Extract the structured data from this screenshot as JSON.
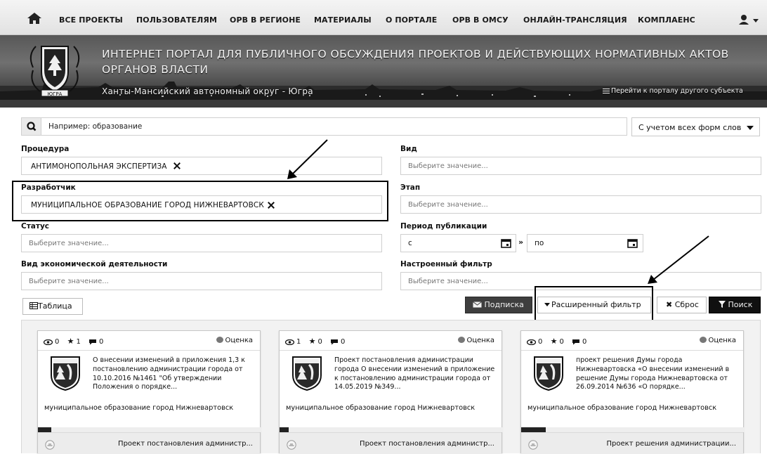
{
  "nav": {
    "items": [
      "ВСЕ ПРОЕКТЫ",
      "ПОЛЬЗОВАТЕЛЯМ",
      "ОРВ В РЕГИОНЕ",
      "МАТЕРИАЛЫ",
      "О ПОРТАЛЕ",
      "ОРВ В ОМСУ",
      "ОНЛАЙН-ТРАНСЛЯЦИЯ",
      "КОМПЛАЕНС"
    ],
    "home_icon": "home-icon",
    "user_icon": "user-icon"
  },
  "banner": {
    "title": "ИНТЕРНЕТ ПОРТАЛ ДЛЯ ПУБЛИЧНОГО ОБСУЖДЕНИЯ ПРОЕКТОВ И ДЕЙСТВУЮЩИХ НОРМАТИВНЫХ АКТОВ ОРГАНОВ ВЛАСТИ",
    "region": "Ханты-Мансийский автономный округ - Югра",
    "emblem_text": "ЮГРА",
    "other_portal_link": "Перейти к порталу другого субъекта"
  },
  "search": {
    "placeholder": "Например: образование",
    "wordform_select": "С учетом всех форм слов"
  },
  "filters": {
    "procedure": {
      "label": "Процедура",
      "value": "АНТИМОНОПОЛЬНАЯ ЭКСПЕРТИЗА"
    },
    "developer": {
      "label": "Разработчик",
      "value": "МУНИЦИПАЛЬНОЕ ОБРАЗОВАНИЕ ГОРОД НИЖНЕВАРТОВСК"
    },
    "status": {
      "label": "Статус",
      "placeholder": "Выберите значение..."
    },
    "activity": {
      "label": "Вид экономической деятельности",
      "placeholder": "Выберите значение..."
    },
    "kind": {
      "label": "Вид",
      "placeholder": "Выберите значение..."
    },
    "stage": {
      "label": "Этап",
      "placeholder": "Выберите значение..."
    },
    "period": {
      "label": "Период публикации",
      "from": "с",
      "to": "по",
      "separator": "»"
    },
    "saved": {
      "label": "Настроенный фильтр",
      "placeholder": "Выберите значение..."
    }
  },
  "buttons": {
    "table": "Таблица",
    "subscribe": "Подписка",
    "advanced": "Расширенный фильтр",
    "reset": "Сброс",
    "search": "Поиск"
  },
  "cards": [
    {
      "views": "0",
      "favorites": "1",
      "comments": "0",
      "rating": "Оценка",
      "description": "О внесении изменений в приложения 1,3 к постановлению администрации города от 10.10.2016 №1461 \"Об утверждении Положения о порядке...",
      "org": "муниципальное образование город Нижневартовск",
      "progress": 0.06,
      "type": "Проект постановления администр..."
    },
    {
      "views": "1",
      "favorites": "0",
      "comments": "0",
      "rating": "Оценка",
      "description": "Проект постановления администрации города О внесении изменений в приложение к постановлению администрации города от 14.05.2019 №349...",
      "org": "муниципальное образование город Нижневартовск",
      "progress": 0.04,
      "type": "Проект постановления администр..."
    },
    {
      "views": "0",
      "favorites": "0",
      "comments": "0",
      "rating": "Оценка",
      "description": "проект решения Думы города Нижневартовска «О внесении изменений в решение Думы города Нижневартовска от 26.09.2014 №636 «О порядке...",
      "org": "муниципальное образование город Нижневартовск",
      "progress": 0.11,
      "type": "Проект решения администрации..."
    }
  ]
}
